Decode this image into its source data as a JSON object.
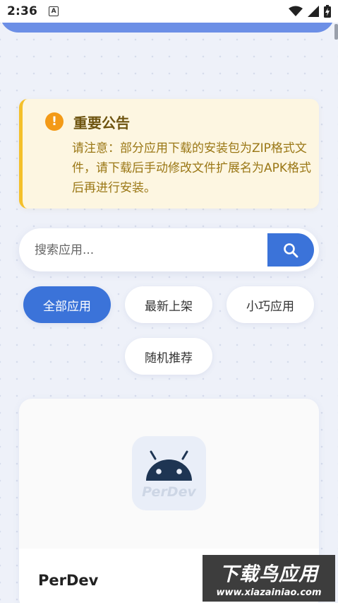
{
  "status_bar": {
    "time": "2:36",
    "notification_icon_letter": "A",
    "icons": [
      "wifi-icon",
      "signal-icon",
      "battery-charging-icon"
    ]
  },
  "notice": {
    "icon": "exclamation-icon",
    "title": "重要公告",
    "body": "请注意：部分应用下载的安装包为ZIP格式文件，请下载后手动修改文件扩展名为APK格式后再进行安装。",
    "accent_color": "#f4c02a"
  },
  "search": {
    "placeholder": "搜索应用...",
    "value": "",
    "button_icon": "search-icon"
  },
  "filters": [
    {
      "label": "全部应用",
      "active": true
    },
    {
      "label": "最新上架",
      "active": false
    },
    {
      "label": "小巧应用",
      "active": false
    },
    {
      "label": "随机推荐",
      "active": false
    }
  ],
  "app_card": {
    "name": "PerDev",
    "icon_text": "PerDev",
    "icon": "android-icon"
  },
  "watermark": {
    "line1": "下载鸟应用",
    "line2": "www.xiazainiao.com"
  },
  "colors": {
    "primary": "#3b73d9",
    "header": "#6c8fe6",
    "background": "#eef1f9",
    "notice_bg": "#fdf6e1"
  }
}
